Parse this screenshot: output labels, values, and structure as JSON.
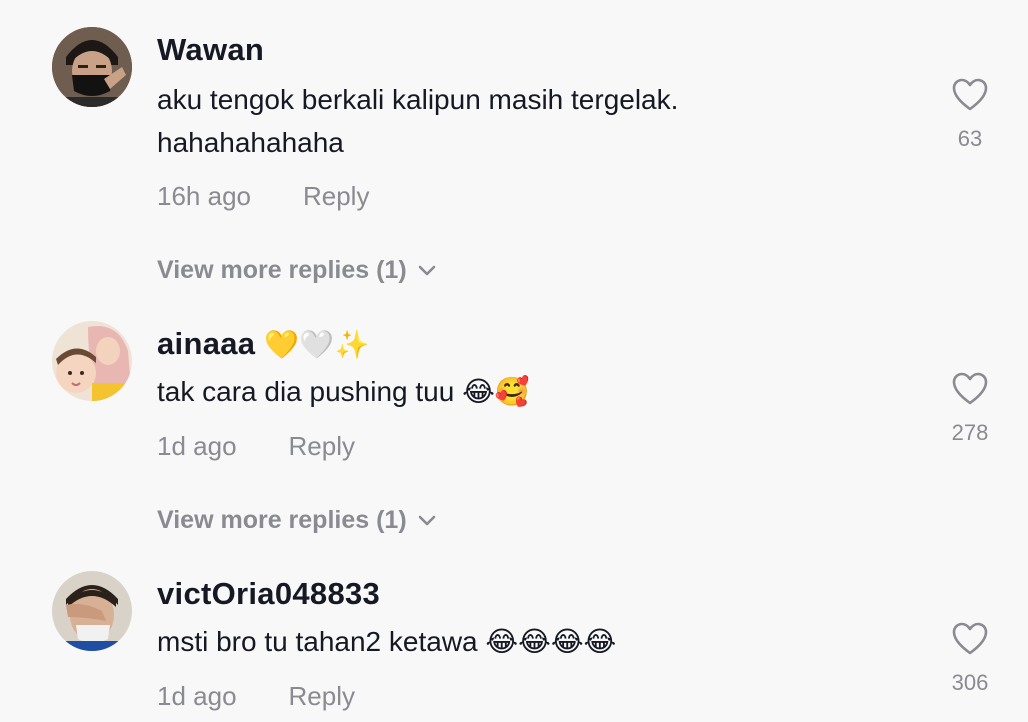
{
  "comments": [
    {
      "username": "Wawan",
      "text_line1": "aku tengok berkali kalipun masih tergelak.",
      "text_line2": "hahahahahaha",
      "time": "16h ago",
      "reply_label": "Reply",
      "likes": "63",
      "more_replies": "View more replies (1)",
      "avatar_icon": "masked-man-avatar"
    },
    {
      "username": "ainaaa",
      "username_emoji": "💛🤍✨",
      "text": "tak cara dia pushing tuu",
      "text_emoji": "😂🥰",
      "time": "1d ago",
      "reply_label": "Reply",
      "likes": "278",
      "more_replies": "View more replies (1)",
      "avatar_icon": "woman-and-child-avatar"
    },
    {
      "username": "victOria048833",
      "text": "msti bro tu tahan2 ketawa",
      "text_emoji": "😂😂😂😂",
      "time": "1d ago",
      "reply_label": "Reply",
      "likes": "306",
      "avatar_icon": "face-palm-avatar"
    }
  ],
  "colors": {
    "background": "#f8f8f8",
    "primary_text": "#161823",
    "secondary_text": "#8a8b91"
  }
}
